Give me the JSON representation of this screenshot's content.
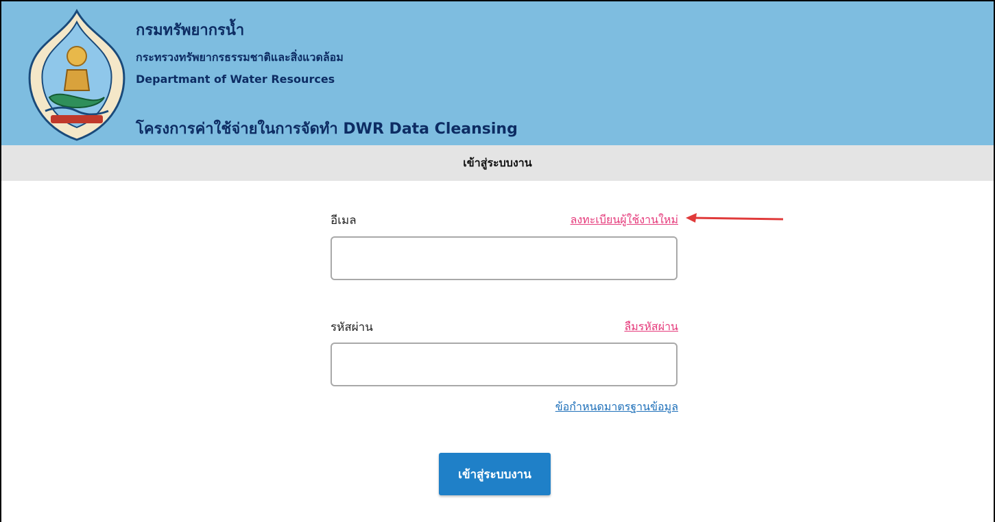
{
  "header": {
    "org_name_th": "กรมทรัพยากรน้ำ",
    "ministry_th": "กระทรวงทรัพยากรธรรมชาติและสิ่งแวดล้อม",
    "org_name_en": "Departmant of Water Resources",
    "project_title": "โครงการค่าใช้จ่ายในการจัดทำ DWR Data Cleansing",
    "logo_icon": "department-emblem-icon"
  },
  "subheader": {
    "title": "เข้าสู่ระบบงาน"
  },
  "form": {
    "email_label": "อีเมล",
    "register_link": "ลงทะเบียนผู้ใช้งานใหม่",
    "email_value": "",
    "password_label": "รหัสผ่าน",
    "forgot_link": "ลืมรหัสผ่าน",
    "password_value": "",
    "standards_link": "ข้อกำหนดมาตรฐานข้อมูล",
    "submit_label": "เข้าสู่ระบบงาน"
  },
  "colors": {
    "header_bg": "#7ebde0",
    "subbar_bg": "#e4e4e4",
    "link_red": "#e5397a",
    "link_blue": "#1d6fb9",
    "button_bg": "#1f80c8",
    "annotation_arrow": "#e03a3a"
  }
}
